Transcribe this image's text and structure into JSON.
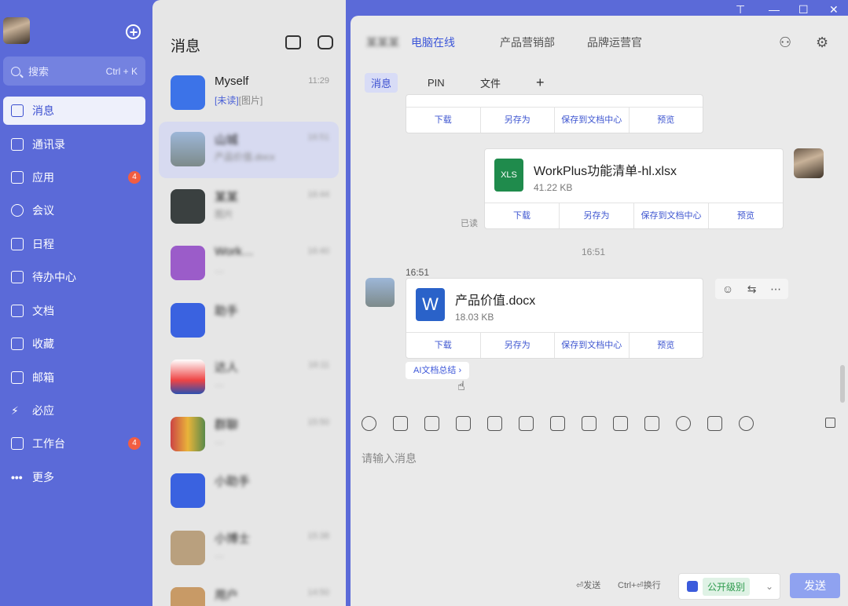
{
  "nav": {
    "search_placeholder": "搜索",
    "search_hint": "Ctrl + K",
    "items": [
      {
        "label": "消息"
      },
      {
        "label": "通讯录"
      },
      {
        "label": "应用",
        "badge": "4"
      },
      {
        "label": "会议"
      },
      {
        "label": "日程"
      },
      {
        "label": "待办中心"
      },
      {
        "label": "文档"
      },
      {
        "label": "收藏"
      },
      {
        "label": "邮箱"
      },
      {
        "label": "必应"
      },
      {
        "label": "工作台",
        "badge": "4"
      },
      {
        "label": "更多"
      }
    ]
  },
  "list": {
    "title": "消息",
    "convs": [
      {
        "name": "Myself",
        "time": "11:29",
        "unread": "[未读]",
        "sub": "[图片]"
      },
      {
        "name": "山城",
        "time": "16:51",
        "sub": "产品价值.docx"
      },
      {
        "name": "某某",
        "time": "16:44",
        "sub": "图片"
      },
      {
        "name": "Work…",
        "time": "16:40",
        "sub": "…"
      },
      {
        "name": "助手",
        "time": "",
        "sub": ""
      },
      {
        "name": "达人",
        "time": "16:11",
        "sub": "…"
      },
      {
        "name": "群聊",
        "time": "15:50",
        "sub": "…"
      },
      {
        "name": "小助手",
        "time": "",
        "sub": ""
      },
      {
        "name": "小博士",
        "time": "15:38",
        "sub": "…"
      },
      {
        "name": "用户",
        "time": "14:50",
        "sub": ""
      }
    ]
  },
  "chat": {
    "head": {
      "name": "某某某",
      "status": "电脑在线",
      "dept": "产品营销部",
      "role": "品牌运营官"
    },
    "tabs": [
      "消息",
      "PIN",
      "文件"
    ],
    "file_actions": [
      "下载",
      "另存为",
      "保存到文档中心",
      "预览"
    ],
    "file1": {
      "name": "WorkPlus功能清单-hl.xlsx",
      "size": "41.22 KB",
      "read": "已读"
    },
    "time_divider": "16:51",
    "msg_time": "16:51",
    "file2": {
      "name": "产品价值.docx",
      "size": "18.03 KB"
    },
    "ai_summary": "AI文档总结",
    "input_placeholder": "请输入消息",
    "hint_send": "⏎发送",
    "hint_newline": "Ctrl+⏎换行",
    "level": "公开级别",
    "send": "发送"
  }
}
